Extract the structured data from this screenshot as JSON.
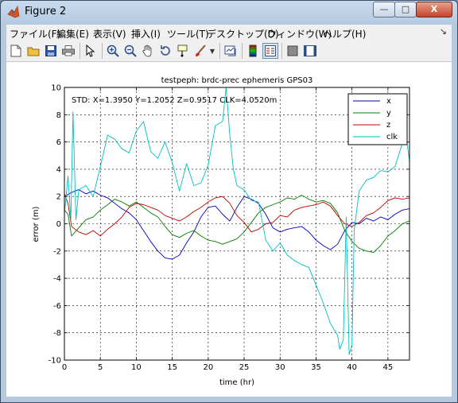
{
  "window": {
    "title": "Figure 2",
    "min_label": "—",
    "max_label": "□",
    "close_label": "X"
  },
  "menu": [
    "ファイル(F)",
    "編集(E)",
    "表示(V)",
    "挿入(I)",
    "ツール(T)",
    "デスクトップ(D)",
    "ウィンドウ(W)",
    "ヘルプ(H)"
  ],
  "toolbar": [
    "new-figure",
    "open-file",
    "save",
    "print",
    "pointer",
    "zoom-in",
    "zoom-out",
    "pan",
    "rotate-3d",
    "data-cursor",
    "brush",
    "link-plot",
    "colorbar",
    "legend",
    "hide-plot-tools",
    "show-plot-tools"
  ],
  "chart_data": {
    "type": "line",
    "title": "testpeph: brdc-prec ephemeris GPS03",
    "annotation": "STD: X=1.3950 Y=1.2052 Z=0.9517 CLK=4.0520m",
    "xlabel": "time (hr)",
    "ylabel": "error (m)",
    "xlim": [
      0,
      48
    ],
    "ylim": [
      -10,
      10
    ],
    "xticks": [
      0,
      5,
      10,
      15,
      20,
      25,
      30,
      35,
      40,
      45
    ],
    "yticks": [
      -10,
      -8,
      -6,
      -4,
      -2,
      0,
      2,
      4,
      6,
      8,
      10
    ],
    "grid": true,
    "legend_position": "top-right",
    "series": [
      {
        "name": "x",
        "color": "#0000bf",
        "points": [
          [
            0,
            2
          ],
          [
            1,
            2.3
          ],
          [
            2,
            2.5
          ],
          [
            3,
            2.2
          ],
          [
            4,
            2.4
          ],
          [
            5,
            2.1
          ],
          [
            6,
            1.9
          ],
          [
            7,
            1.5
          ],
          [
            8,
            1.1
          ],
          [
            9,
            0.8
          ],
          [
            10,
            0.3
          ],
          [
            11,
            -0.5
          ],
          [
            12,
            -1.3
          ],
          [
            13,
            -2
          ],
          [
            14,
            -2.5
          ],
          [
            15,
            -2.6
          ],
          [
            16,
            -2.3
          ],
          [
            17,
            -1.4
          ],
          [
            18,
            -0.6
          ],
          [
            19,
            0.5
          ],
          [
            20,
            1.2
          ],
          [
            21,
            1.3
          ],
          [
            22,
            0.7
          ],
          [
            23,
            0.2
          ],
          [
            24,
            1.2
          ],
          [
            25,
            2
          ],
          [
            26,
            1.8
          ],
          [
            27,
            1.5
          ],
          [
            28,
            0.7
          ],
          [
            29,
            -0.3
          ],
          [
            30,
            -0.6
          ],
          [
            31,
            -0.4
          ],
          [
            32,
            -0.3
          ],
          [
            33,
            -0.2
          ],
          [
            34,
            -0.6
          ],
          [
            35,
            -1.2
          ],
          [
            36,
            -1.6
          ],
          [
            37,
            -1.9
          ],
          [
            38,
            -1.5
          ],
          [
            39,
            -0.5
          ],
          [
            40,
            0.1
          ],
          [
            41,
            0
          ],
          [
            42,
            0.4
          ],
          [
            43,
            0.2
          ],
          [
            44,
            0.5
          ],
          [
            45,
            0.3
          ],
          [
            46,
            0.7
          ],
          [
            47,
            1
          ],
          [
            48,
            1.1
          ]
        ]
      },
      {
        "name": "y",
        "color": "#007f00",
        "points": [
          [
            0,
            1
          ],
          [
            0.5,
            0.7
          ],
          [
            1,
            -0.9
          ],
          [
            2,
            -0.3
          ],
          [
            3,
            0.3
          ],
          [
            4,
            0.5
          ],
          [
            5,
            1
          ],
          [
            6,
            1.4
          ],
          [
            7,
            1.8
          ],
          [
            8,
            1.6
          ],
          [
            9,
            1.3
          ],
          [
            10,
            1.6
          ],
          [
            11,
            1.2
          ],
          [
            12,
            0.8
          ],
          [
            13,
            0.5
          ],
          [
            14,
            -0.2
          ],
          [
            15,
            -0.8
          ],
          [
            16,
            -1
          ],
          [
            17,
            -0.7
          ],
          [
            18,
            -0.5
          ],
          [
            19,
            -0.9
          ],
          [
            20,
            -1.2
          ],
          [
            21,
            -1.3
          ],
          [
            22,
            -1.5
          ],
          [
            23,
            -1.3
          ],
          [
            24,
            -1.1
          ],
          [
            25,
            -0.6
          ],
          [
            26,
            0.1
          ],
          [
            27,
            0.8
          ],
          [
            28,
            1.2
          ],
          [
            29,
            1.4
          ],
          [
            30,
            1.6
          ],
          [
            31,
            1.9
          ],
          [
            32,
            1.8
          ],
          [
            33,
            2.1
          ],
          [
            34,
            1.8
          ],
          [
            35,
            1.6
          ],
          [
            36,
            1.7
          ],
          [
            37,
            1.5
          ],
          [
            38,
            0.8
          ],
          [
            39,
            -0.5
          ],
          [
            40,
            -1.3
          ],
          [
            41,
            -1.8
          ],
          [
            42,
            -2
          ],
          [
            43,
            -2.1
          ],
          [
            44,
            -1.6
          ],
          [
            45,
            -0.9
          ],
          [
            46,
            -0.5
          ],
          [
            47,
            0
          ],
          [
            48,
            0.2
          ]
        ]
      },
      {
        "name": "z",
        "color": "#bf0000",
        "points": [
          [
            0,
            2.2
          ],
          [
            0.5,
            1.5
          ],
          [
            1,
            -0.2
          ],
          [
            2,
            -0.6
          ],
          [
            3,
            -0.8
          ],
          [
            4,
            -0.5
          ],
          [
            5,
            -0.9
          ],
          [
            6,
            -0.4
          ],
          [
            7,
            0
          ],
          [
            8,
            0.5
          ],
          [
            9,
            1.2
          ],
          [
            10,
            1.5
          ],
          [
            11,
            1.4
          ],
          [
            12,
            1.2
          ],
          [
            13,
            1
          ],
          [
            14,
            0.6
          ],
          [
            15,
            0.4
          ],
          [
            16,
            0.2
          ],
          [
            17,
            0.5
          ],
          [
            18,
            0.9
          ],
          [
            19,
            1.2
          ],
          [
            20,
            1.6
          ],
          [
            21,
            1.9
          ],
          [
            22,
            2
          ],
          [
            23,
            1.5
          ],
          [
            24,
            0.6
          ],
          [
            25,
            0.1
          ],
          [
            26,
            -0.6
          ],
          [
            27,
            -0.4
          ],
          [
            28,
            0
          ],
          [
            29,
            0.1
          ],
          [
            30,
            0.6
          ],
          [
            31,
            0.5
          ],
          [
            32,
            1
          ],
          [
            33,
            1.2
          ],
          [
            34,
            1.3
          ],
          [
            35,
            1.4
          ],
          [
            36,
            1.6
          ],
          [
            37,
            1.3
          ],
          [
            38,
            0.6
          ],
          [
            39,
            0
          ],
          [
            40,
            -0.2
          ],
          [
            41,
            0.1
          ],
          [
            42,
            0.6
          ],
          [
            43,
            0.8
          ],
          [
            44,
            1.2
          ],
          [
            45,
            1.7
          ],
          [
            46,
            1.9
          ],
          [
            47,
            1.8
          ],
          [
            48,
            1.9
          ]
        ]
      },
      {
        "name": "clk",
        "color": "#00bfbf",
        "points": [
          [
            0,
            0.7
          ],
          [
            0.5,
            3.5
          ],
          [
            0.9,
            0.3
          ],
          [
            1.2,
            8.2
          ],
          [
            1.6,
            0.3
          ],
          [
            2,
            2.5
          ],
          [
            3,
            2.8
          ],
          [
            4,
            2
          ],
          [
            5,
            4.2
          ],
          [
            6,
            6.5
          ],
          [
            7,
            6.2
          ],
          [
            8,
            5.5
          ],
          [
            9,
            5.2
          ],
          [
            10,
            6.8
          ],
          [
            11,
            7.5
          ],
          [
            12,
            5.3
          ],
          [
            13,
            4.8
          ],
          [
            14,
            6
          ],
          [
            15,
            4.5
          ],
          [
            16,
            2.4
          ],
          [
            17,
            4.4
          ],
          [
            18,
            2.8
          ],
          [
            19,
            3
          ],
          [
            20,
            4.3
          ],
          [
            21,
            7.2
          ],
          [
            22,
            7.5
          ],
          [
            22.5,
            10
          ],
          [
            23,
            6.5
          ],
          [
            23.5,
            4
          ],
          [
            24,
            2.8
          ],
          [
            25,
            2.5
          ],
          [
            26,
            1.7
          ],
          [
            27,
            1.6
          ],
          [
            28,
            -1.2
          ],
          [
            29,
            -2
          ],
          [
            30,
            -1.4
          ],
          [
            31,
            -2.3
          ],
          [
            32,
            -2.7
          ],
          [
            33,
            -3
          ],
          [
            34,
            -3.2
          ],
          [
            35,
            -4.5
          ],
          [
            36,
            -5.8
          ],
          [
            37,
            -7.3
          ],
          [
            38,
            -8.2
          ],
          [
            38.3,
            -9.2
          ],
          [
            38.8,
            -8.5
          ],
          [
            39.2,
            0.5
          ],
          [
            39.6,
            -9.6
          ],
          [
            40,
            -8.9
          ],
          [
            40.3,
            -0.5
          ],
          [
            41,
            2.4
          ],
          [
            42,
            3.2
          ],
          [
            43,
            3.4
          ],
          [
            44,
            3.9
          ],
          [
            45,
            3.8
          ],
          [
            46,
            4.2
          ],
          [
            47,
            5.9
          ],
          [
            47.5,
            6.5
          ],
          [
            48,
            4.6
          ]
        ]
      }
    ]
  }
}
